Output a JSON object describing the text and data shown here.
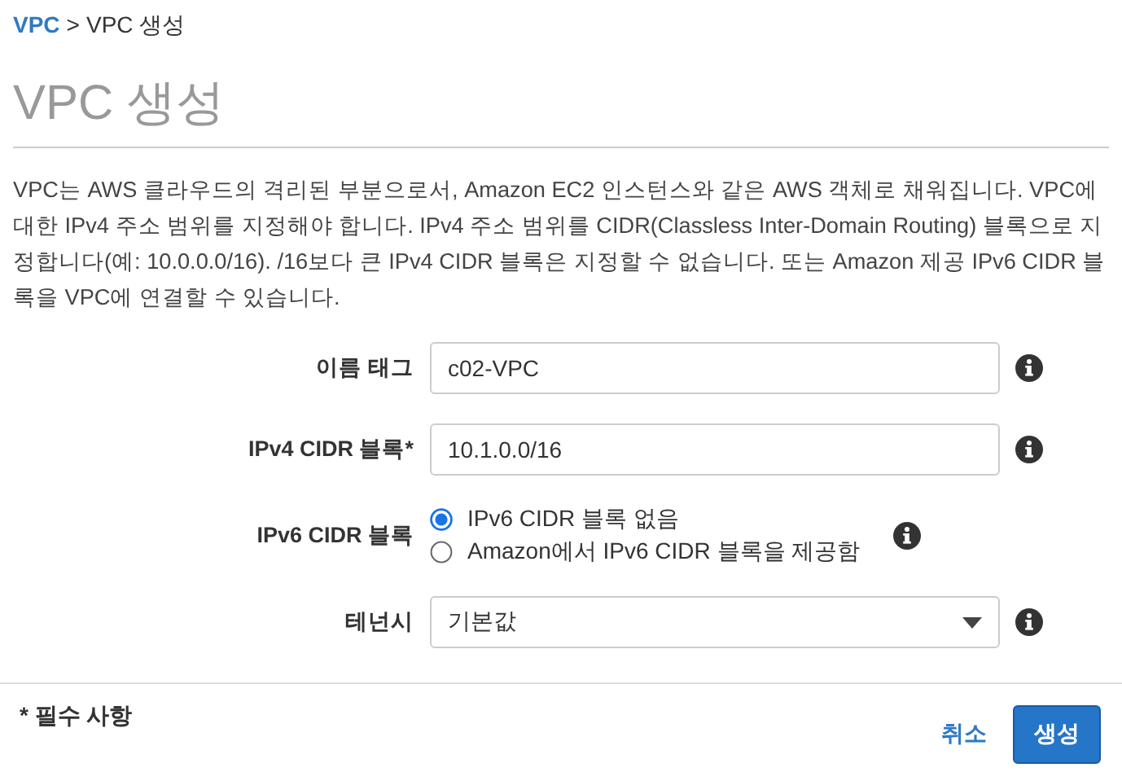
{
  "breadcrumb": {
    "link": "VPC",
    "separator": ">",
    "current": "VPC 생성"
  },
  "title": "VPC 생성",
  "description": "VPC는 AWS 클라우드의 격리된 부분으로서, Amazon EC2 인스턴스와 같은 AWS 객체로 채워집니다. VPC에 대한 IPv4 주소 범위를 지정해야 합니다. IPv4 주소 범위를 CIDR(Classless Inter-Domain Routing) 블록으로 지정합니다(예: 10.0.0.0/16). /16보다 큰 IPv4 CIDR 블록은 지정할 수 없습니다. 또는 Amazon 제공 IPv6 CIDR 블록을 VPC에 연결할 수 있습니다.",
  "form": [
    {
      "kind": "text",
      "label": "이름 태그",
      "value": "c02-VPC"
    },
    {
      "kind": "text",
      "label": "IPv4 CIDR 블록*",
      "value": "10.1.0.0/16"
    },
    {
      "kind": "radio",
      "label": "IPv6 CIDR 블록",
      "options": [
        {
          "label": "IPv6 CIDR 블록 없음",
          "selected": true
        },
        {
          "label": "Amazon에서 IPv6 CIDR 블록을 제공함",
          "selected": false
        }
      ]
    },
    {
      "kind": "select",
      "label": "테넌시",
      "value": "기본값"
    }
  ],
  "footer": {
    "note": "* 필수 사항",
    "cancel": "취소",
    "submit": "생성"
  }
}
